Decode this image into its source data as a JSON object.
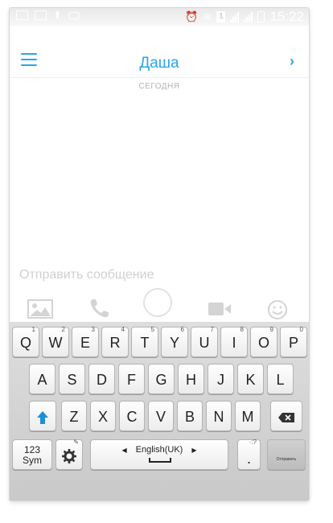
{
  "status_bar": {
    "time": "15:22",
    "sim_slot": "1"
  },
  "header": {
    "contact_name": "Даша"
  },
  "conversation": {
    "date_label": "СЕГОДНЯ"
  },
  "compose": {
    "placeholder": "Отправить сообщение"
  },
  "keyboard": {
    "row1": [
      {
        "label": "Q",
        "hint": "1"
      },
      {
        "label": "W",
        "hint": "2"
      },
      {
        "label": "E",
        "hint": "3"
      },
      {
        "label": "R",
        "hint": "4"
      },
      {
        "label": "T",
        "hint": "5"
      },
      {
        "label": "Y",
        "hint": "6"
      },
      {
        "label": "U",
        "hint": "7"
      },
      {
        "label": "I",
        "hint": "8"
      },
      {
        "label": "O",
        "hint": "9"
      },
      {
        "label": "P",
        "hint": "0"
      }
    ],
    "row2": [
      "A",
      "S",
      "D",
      "F",
      "G",
      "H",
      "J",
      "K",
      "L"
    ],
    "row3": [
      "Z",
      "X",
      "C",
      "V",
      "B",
      "N",
      "M"
    ],
    "sym_label_top": "123",
    "sym_label_bottom": "Sym",
    "language": "English(UK)",
    "period": ".",
    "period_hint": "·:?",
    "send_label": "Отправить"
  },
  "colors": {
    "accent": "#27a7e6"
  }
}
